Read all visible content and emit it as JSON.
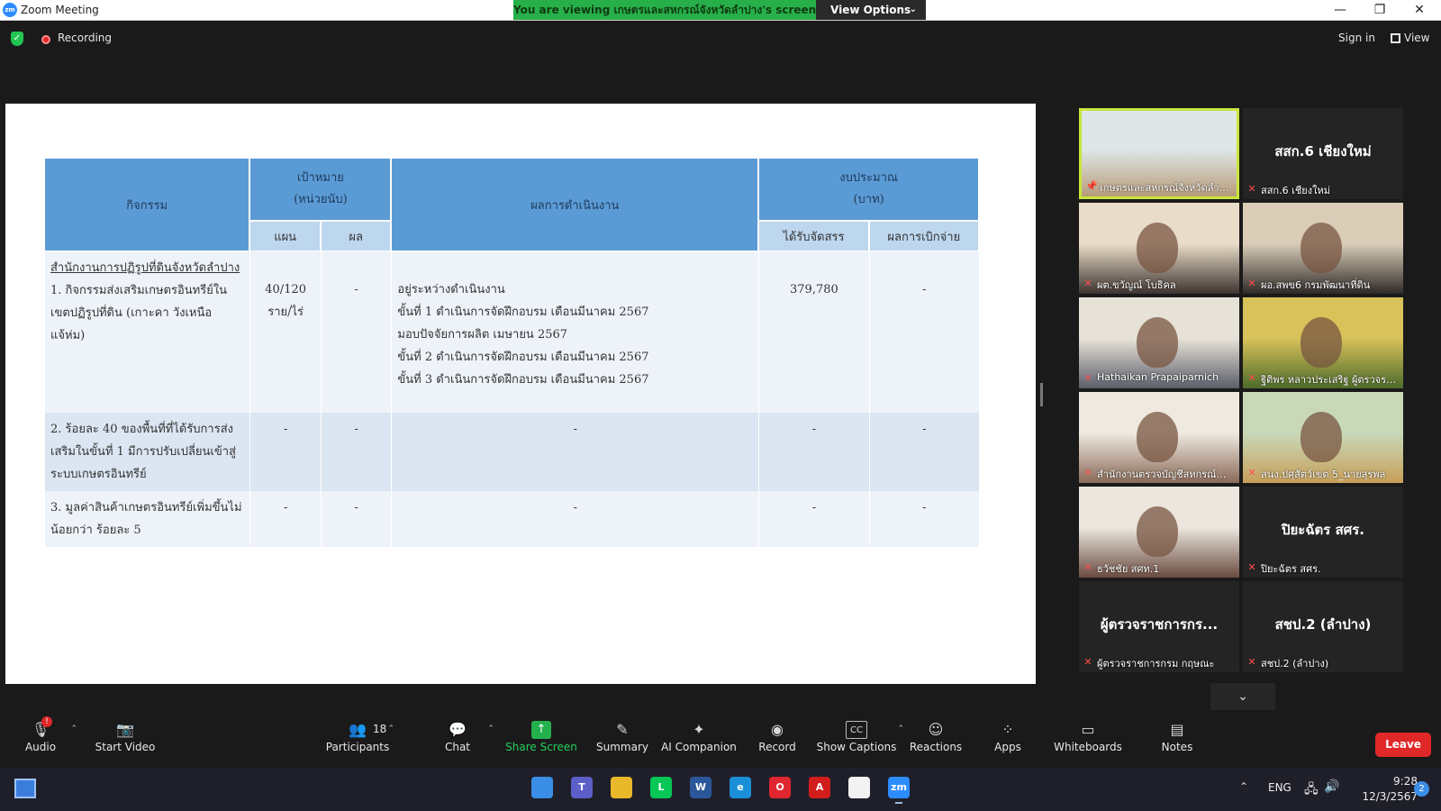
{
  "window": {
    "title": "Zoom Meeting",
    "app_logo": "zm",
    "controls": {
      "minimize": "—",
      "maximize": "❐",
      "close": "✕"
    }
  },
  "share_banner": {
    "text": "You are viewing เกษตรและสหกรณ์จังหวัดลำปาง's screen",
    "view_options": "View Options"
  },
  "topbar": {
    "recording": "Recording",
    "sign_in": "Sign in",
    "view": "View"
  },
  "slide": {
    "headers": {
      "activity": "กิจกรรม",
      "target": "เป้าหมาย",
      "target_unit": "(หน่วยนับ)",
      "result": "ผลการดำเนินงาน",
      "budget": "งบประมาณ",
      "budget_unit": "(บาท)",
      "plan": "แผน",
      "outcome": "ผล",
      "allocated": "ได้รับจัดสรร",
      "disbursed": "ผลการเบิกจ่าย"
    },
    "rows": [
      {
        "org": "สำนักงานการปฏิรูปที่ดินจังหวัดลำปาง",
        "activity": "1. กิจกรรมส่งเสริมเกษตรอินทรีย์ในเขตปฏิรูปที่ดิน (เกาะคา วังเหนือ แจ้ห่ม)",
        "plan": "40/120 ราย/ไร่",
        "outcome": "-",
        "result_lines": [
          "อยู่ระหว่างดำเนินงาน",
          "ขั้นที่ 1 ดำเนินการจัดฝึกอบรม เดือนมีนาคม 2567",
          "มอบปัจจัยการผลิต เมษายน 2567",
          "ขั้นที่ 2 ดำเนินการจัดฝึกอบรม เดือนมีนาคม 2567",
          "ขั้นที่ 3 ดำเนินการจัดฝึกอบรม เดือนมีนาคม 2567"
        ],
        "allocated": "379,780",
        "disbursed": "-"
      },
      {
        "activity": "2. ร้อยละ 40 ของพื้นที่ที่ได้รับการส่งเสริมในขั้นที่ 1 มีการปรับเปลี่ยนเข้าสู่ระบบเกษตรอินทรีย์",
        "plan": "-",
        "outcome": "-",
        "result": "-",
        "allocated": "-",
        "disbursed": "-"
      },
      {
        "activity": "3. มูลค่าสินค้าเกษตรอินทรีย์เพิ่มขึ้นไม่น้อยกว่า ร้อยละ 5",
        "plan": "-",
        "outcome": "-",
        "result": "-",
        "allocated": "-",
        "disbursed": "-"
      }
    ]
  },
  "gallery": {
    "tiles": [
      {
        "name": "เกษตรและสหกรณ์จังหวัดลำปาง",
        "big": "",
        "video": true,
        "active": true,
        "colors": [
          "#dfe6e8",
          "#b89c7a"
        ]
      },
      {
        "name": "สสก.6 เชียงใหม่",
        "big": "สสก.6 เชียงใหม่",
        "video": false
      },
      {
        "name": "ผต.ขวัญณ์ โบธิคล",
        "big": "",
        "video": true,
        "colors": [
          "#e9dcc8",
          "#3d3430"
        ]
      },
      {
        "name": "ผอ.สพข6 กรมพัฒนาที่ดิน",
        "big": "",
        "video": true,
        "colors": [
          "#d9cdb8",
          "#2f2a28"
        ]
      },
      {
        "name": "Hathaikan Prapaiparnich",
        "big": "",
        "video": true,
        "colors": [
          "#e7e2d8",
          "#5b5e69"
        ]
      },
      {
        "name": "ฐิติพร หลาวประเสริฐ ผู้ตรวจราชการ",
        "big": "",
        "video": true,
        "colors": [
          "#d8c25a",
          "#4d6b2a"
        ]
      },
      {
        "name": "สำนักงานตรวจบัญชีสหกรณ์ลำปาง",
        "big": "",
        "video": true,
        "colors": [
          "#efe9e0",
          "#8a6a58"
        ]
      },
      {
        "name": "สนง.ปศุสัตว์เขต 5_นายสุรพล",
        "big": "",
        "video": true,
        "colors": [
          "#c8d8b8",
          "#c7a05a"
        ]
      },
      {
        "name": "ธวัชชัย สศท.1",
        "big": "",
        "video": true,
        "colors": [
          "#ece6de",
          "#6a4b40"
        ]
      },
      {
        "name": "ปิยะฉัตร สศร.",
        "big": "ปิยะฉัตร สศร.",
        "video": false
      },
      {
        "name": "ผู้ตรวจราชการกรม กฤษณะ",
        "big": "ผู้ตรวจราชการกร...",
        "video": false
      },
      {
        "name": "สชป.2 (ลำปาง)",
        "big": "สชป.2 (ลำปาง)",
        "video": false
      }
    ]
  },
  "toolbar": {
    "audio": "Audio",
    "start_video": "Start Video",
    "participants": "Participants",
    "participant_count": "18",
    "chat": "Chat",
    "share_screen": "Share Screen",
    "summary": "Summary",
    "ai_companion": "AI Companion",
    "record": "Record",
    "show_captions": "Show Captions",
    "reactions": "Reactions",
    "apps": "Apps",
    "whiteboards": "Whiteboards",
    "notes": "Notes",
    "leave": "Leave",
    "audio_badge": "!"
  },
  "taskbar": {
    "apps": [
      {
        "name": "windows-start",
        "label": "",
        "color": "#3a8ee6"
      },
      {
        "name": "teams",
        "label": "T",
        "color": "#5b5fc7"
      },
      {
        "name": "file-explorer",
        "label": "",
        "color": "#e8b82a"
      },
      {
        "name": "line",
        "label": "L",
        "color": "#06c755"
      },
      {
        "name": "word",
        "label": "W",
        "color": "#2b579a"
      },
      {
        "name": "edge",
        "label": "e",
        "color": "#1a8fd8"
      },
      {
        "name": "opera",
        "label": "O",
        "color": "#e0262e"
      },
      {
        "name": "acrobat",
        "label": "A",
        "color": "#d21d1d"
      },
      {
        "name": "notepad",
        "label": "",
        "color": "#f2f2f2"
      },
      {
        "name": "zoom",
        "label": "zm",
        "color": "#2d8cff",
        "active": true
      }
    ],
    "language": "ENG",
    "time": "9:28",
    "date": "12/3/2567",
    "notifications": "2"
  }
}
